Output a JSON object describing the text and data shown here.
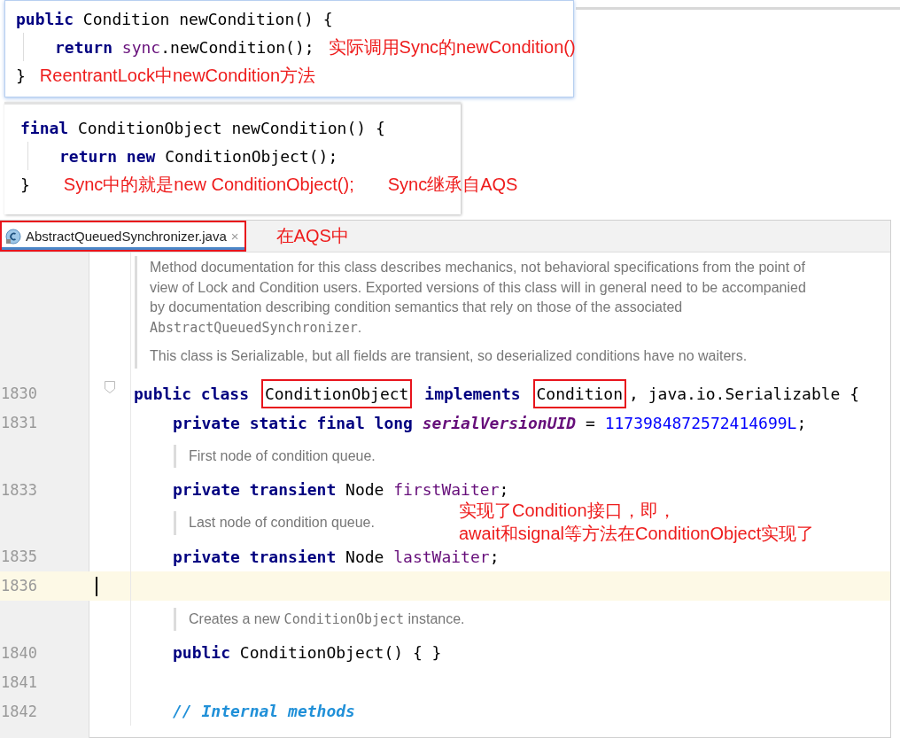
{
  "snippets": [
    {
      "lines": [
        {
          "tokens": [
            {
              "t": "public",
              "kind": "kw"
            },
            {
              "t": " Condition newCondition() {",
              "kind": "plain"
            }
          ],
          "children": [
            {
              "tokens": [
                {
                  "t": "return ",
                  "kind": "kw"
                },
                {
                  "t": "sync",
                  "kind": "field"
                },
                {
                  "t": ".newCondition();",
                  "kind": "plain"
                }
              ],
              "notes": [
                "实际调用Sync的newCondition()"
              ]
            }
          ]
        },
        {
          "tokens": [
            {
              "t": "}",
              "kind": "plain"
            }
          ],
          "notes": [
            "ReentrantLock中newCondition方法"
          ]
        }
      ]
    },
    {
      "lines": [
        {
          "tokens": [
            {
              "t": "final",
              "kind": "kw"
            },
            {
              "t": " ConditionObject newCondition() {",
              "kind": "plain"
            }
          ],
          "children": [
            {
              "tokens": [
                {
                  "t": "return new",
                  "kind": "kw"
                },
                {
                  "t": " ConditionObject();",
                  "kind": "plain"
                }
              ]
            }
          ]
        },
        {
          "tokens": [
            {
              "t": "}",
              "kind": "plain"
            }
          ],
          "notes": [
            "Sync中的就是new ConditionObject();",
            "Sync继承自AQS"
          ]
        }
      ]
    }
  ],
  "editor": {
    "tab": {
      "label": "AbstractQueuedSynchronizer.java",
      "close": "×",
      "selected": true,
      "highlighted": true,
      "note": "在AQS中"
    },
    "rows": [
      {
        "kind": "doc",
        "paragraphs": [
          [
            {
              "t": "Method documentation for this class describes mechanics, not behavioral specifications from the point of view of Lock and Condition users. Exported versions of this class will in general need to be accompanied by documentation describing condition semantics that rely on those of the associated "
            },
            {
              "t": "AbstractQueuedSynchronizer",
              "code": true
            },
            {
              "t": "."
            }
          ],
          [
            {
              "t": "This class is Serializable, but all fields are transient, so deserialized conditions have no waiters."
            }
          ]
        ]
      },
      {
        "kind": "code",
        "number": "1830",
        "foldable": true,
        "tokens": [
          {
            "t": "public class ",
            "kind": "kw"
          },
          {
            "t": "ConditionObject",
            "kind": "plain",
            "highlighted": true
          },
          {
            "t": " implements ",
            "kind": "kw"
          },
          {
            "t": "Condition",
            "kind": "plain",
            "highlighted": true
          },
          {
            "t": ", java.io.Serializable {",
            "kind": "plain"
          }
        ],
        "children": [
          {
            "kind": "code",
            "number": "1831",
            "tokens": [
              {
                "t": "private static final long ",
                "kind": "kw"
              },
              {
                "t": "serialVersionUID",
                "kind": "constant"
              },
              {
                "t": " = ",
                "kind": "plain"
              },
              {
                "t": "1173984872572414699L",
                "kind": "num"
              },
              {
                "t": ";",
                "kind": "plain"
              }
            ]
          },
          {
            "kind": "doc",
            "paragraphs": [
              [
                {
                  "t": "First node of condition queue."
                }
              ]
            ]
          },
          {
            "kind": "code",
            "number": "1833",
            "tokens": [
              {
                "t": "private transient",
                "kind": "kw"
              },
              {
                "t": " Node ",
                "kind": "plain"
              },
              {
                "t": "firstWaiter",
                "kind": "field"
              },
              {
                "t": ";",
                "kind": "plain"
              }
            ]
          },
          {
            "kind": "doc",
            "paragraphs": [
              [
                {
                  "t": "Last node of condition queue."
                }
              ]
            ]
          },
          {
            "kind": "code",
            "number": "1835",
            "tokens": [
              {
                "t": "private transient",
                "kind": "kw"
              },
              {
                "t": " Node ",
                "kind": "plain"
              },
              {
                "t": "lastWaiter",
                "kind": "field"
              },
              {
                "t": ";",
                "kind": "plain"
              }
            ]
          },
          {
            "kind": "code",
            "number": "1836",
            "current": true
          },
          {
            "kind": "doc",
            "paragraphs": [
              [
                {
                  "t": "Creates a new "
                },
                {
                  "t": "ConditionObject",
                  "code": true
                },
                {
                  "t": " instance."
                }
              ]
            ]
          },
          {
            "kind": "code",
            "number": "1840",
            "tokens": [
              {
                "t": "public",
                "kind": "kw"
              },
              {
                "t": " ConditionObject() { }",
                "kind": "plain"
              }
            ]
          },
          {
            "kind": "code",
            "number": "1841"
          },
          {
            "kind": "code",
            "number": "1842",
            "tokens": [
              {
                "t": "// Internal methods",
                "kind": "comment"
              }
            ]
          }
        ]
      }
    ],
    "notes": [
      "实现了Condition接口，即，",
      "await和signal等方法在ConditionObject实现了"
    ]
  }
}
